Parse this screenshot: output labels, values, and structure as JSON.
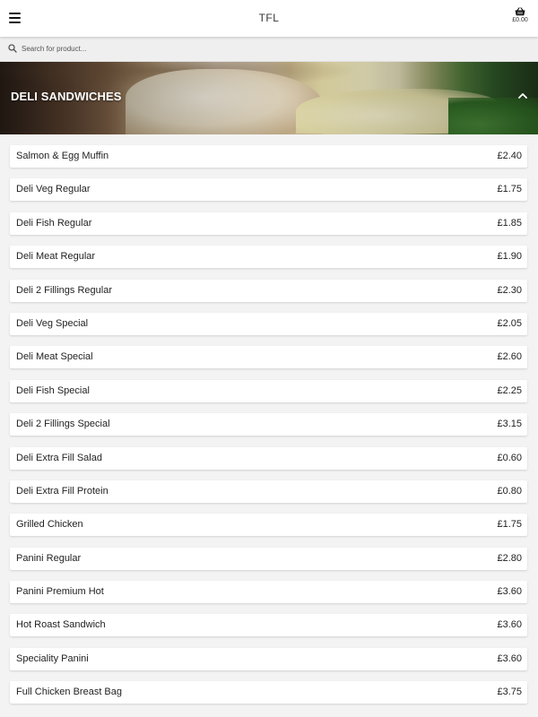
{
  "header": {
    "title": "TFL",
    "menu_icon": "hamburger-menu-icon",
    "cart_icon": "basket-icon",
    "cart_total": "£0.00"
  },
  "search": {
    "placeholder": "Search for product...",
    "icon": "search-icon"
  },
  "category": {
    "title": "DELI SANDWICHES",
    "toggle_icon": "chevron-up-icon",
    "expanded": true
  },
  "items": [
    {
      "name": "Salmon & Egg Muffin",
      "price": "£2.40"
    },
    {
      "name": "Deli Veg Regular",
      "price": "£1.75"
    },
    {
      "name": "Deli Fish Regular",
      "price": "£1.85"
    },
    {
      "name": "Deli Meat Regular",
      "price": "£1.90"
    },
    {
      "name": "Deli 2 Fillings Regular",
      "price": "£2.30"
    },
    {
      "name": "Deli Veg Special",
      "price": "£2.05"
    },
    {
      "name": "Deli Meat Special",
      "price": "£2.60"
    },
    {
      "name": "Deli Fish Special",
      "price": "£2.25"
    },
    {
      "name": "Deli 2 Fillings Special",
      "price": "£3.15"
    },
    {
      "name": "Deli Extra Fill Salad",
      "price": "£0.60"
    },
    {
      "name": "Deli Extra Fill Protein",
      "price": "£0.80"
    },
    {
      "name": "Grilled Chicken",
      "price": "£1.75"
    },
    {
      "name": "Panini Regular",
      "price": "£2.80"
    },
    {
      "name": "Panini Premium Hot",
      "price": "£3.60"
    },
    {
      "name": "Hot Roast Sandwich",
      "price": "£3.60"
    },
    {
      "name": "Speciality Panini",
      "price": "£3.60"
    },
    {
      "name": "Full Chicken Breast Bag",
      "price": "£3.75"
    }
  ]
}
